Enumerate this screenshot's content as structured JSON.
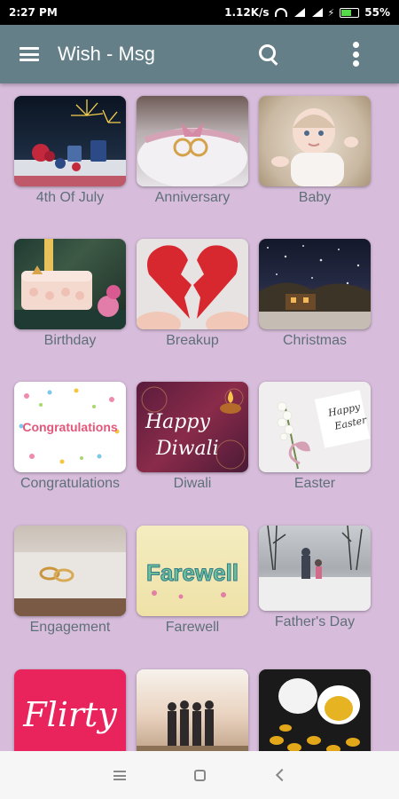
{
  "status_bar": {
    "time": "2:27 PM",
    "speed": "1.12K/s",
    "battery": "55%"
  },
  "toolbar": {
    "title": "Wish - Msg"
  },
  "categories": [
    {
      "label": "4th Of July"
    },
    {
      "label": "Anniversary"
    },
    {
      "label": "Baby"
    },
    {
      "label": "Birthday"
    },
    {
      "label": "Breakup"
    },
    {
      "label": "Christmas"
    },
    {
      "label": "Congratulations"
    },
    {
      "label": "Diwali"
    },
    {
      "label": "Easter"
    },
    {
      "label": "Engagement"
    },
    {
      "label": "Farewell"
    },
    {
      "label": "Father's Day"
    },
    {
      "label": "Flirty",
      "thumb_text": "Flirty"
    },
    {
      "label": ""
    },
    {
      "label": ""
    }
  ],
  "thumb_text": {
    "congrats": "Congratulations",
    "diwali_1": "Happy",
    "diwali_2": "Diwali",
    "easter_1": "Happy",
    "easter_2": "Easter",
    "farewell": "Farewell",
    "flirty": "Flirty"
  },
  "colors": {
    "background": "#d7bddb",
    "toolbar": "#647f87",
    "label": "#5f6f78"
  }
}
